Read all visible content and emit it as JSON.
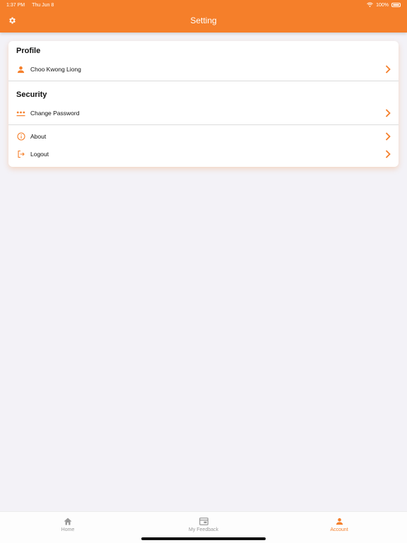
{
  "status_bar": {
    "time": "1:37 PM",
    "date": "Thu Jun 8",
    "battery": "100%"
  },
  "header": {
    "title": "Setting"
  },
  "profile": {
    "title": "Profile",
    "name": "Choo Kwong Liong"
  },
  "security": {
    "title": "Security",
    "items": [
      {
        "label": "Change Password",
        "icon": "password-dots-icon"
      },
      {
        "label": "About",
        "icon": "info-icon"
      },
      {
        "label": "Logout",
        "icon": "logout-icon"
      }
    ]
  },
  "tabs": [
    {
      "label": "Home",
      "icon": "home-icon",
      "active": false
    },
    {
      "label": "My Feedback",
      "icon": "feedback-icon",
      "active": false
    },
    {
      "label": "Account",
      "icon": "person-icon",
      "active": true
    }
  ],
  "colors": {
    "accent": "#f57f2a",
    "background": "#f3f2f7",
    "inactive": "#9a9a9a"
  }
}
